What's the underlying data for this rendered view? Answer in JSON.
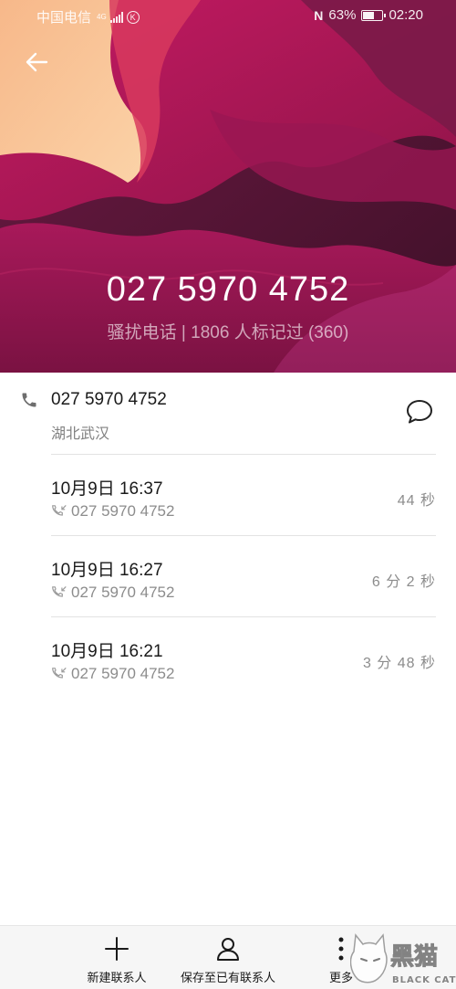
{
  "status_bar": {
    "carrier": "中国电信",
    "network": "4G",
    "carrier_badge": "K",
    "nfc": "N",
    "battery": "63%",
    "battery_level": 0.63,
    "time": "02:20"
  },
  "header": {
    "phone_number": "027 5970 4752",
    "tag": "骚扰电话 | 1806 人标记过 (360)",
    "back_icon": "arrow-left-icon",
    "colors": {
      "light": "#f5c49a",
      "magenta": "#b8185f",
      "dark": "#5e1838"
    }
  },
  "contact_info": {
    "number": "027 5970 4752",
    "location": "湖北武汉",
    "phone_icon": "phone-icon",
    "message_icon": "message-bubble-icon"
  },
  "call_log": [
    {
      "datetime": "10月9日 16:37",
      "number": "027 5970 4752",
      "duration": "44 秒"
    },
    {
      "datetime": "10月9日 16:27",
      "number": "027 5970 4752",
      "duration": "6 分 2 秒"
    },
    {
      "datetime": "10月9日 16:21",
      "number": "027 5970 4752",
      "duration": "3 分 48 秒"
    }
  ],
  "bottom_actions": {
    "new_contact": "新建联系人",
    "save_existing": "保存至已有联系人",
    "more": "更多"
  },
  "watermark": {
    "text_cn": "黑猫",
    "text_en": "BLACK CAT"
  }
}
